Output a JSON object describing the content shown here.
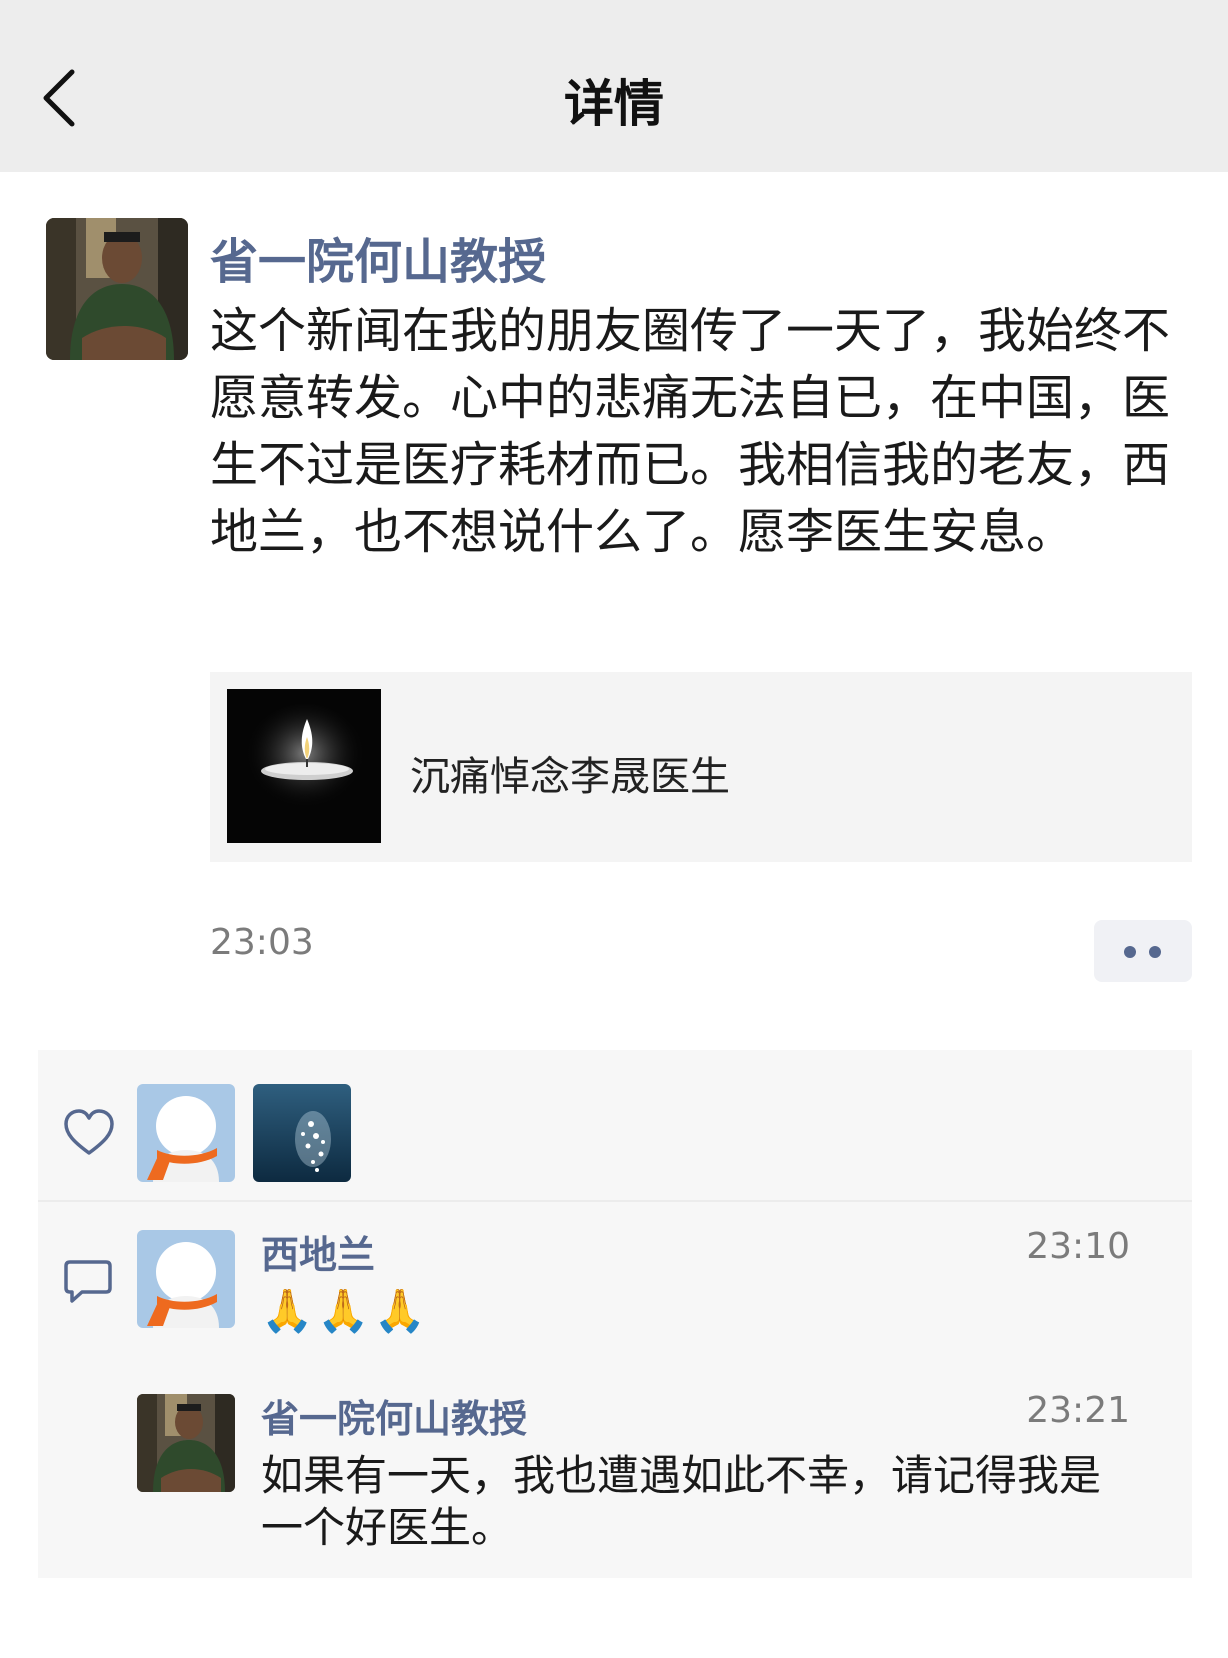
{
  "header": {
    "title": "详情",
    "back_icon": "chevron-left-icon"
  },
  "post": {
    "author": "省一院何山教授",
    "text": "这个新闻在我的朋友圈传了一天了，我始终不愿意转发。心中的悲痛无法自已，在中国，医生不过是医疗耗材而已。我相信我的老友，西地兰，也不想说什么了。愿李医生安息。",
    "link": {
      "title": "沉痛悼念李晟医生",
      "thumb_icon": "candle-icon"
    },
    "time": "23:03",
    "more_icon": "more-dots-icon"
  },
  "likes": {
    "icon": "heart-icon",
    "users": [
      "avatar-scarf",
      "avatar-water"
    ]
  },
  "comments": {
    "icon": "comment-icon",
    "items": [
      {
        "author": "西地兰",
        "time": "23:10",
        "text": "🙏🙏🙏"
      },
      {
        "author": "省一院何山教授",
        "time": "23:21",
        "text": "如果有一天，我也遭遇如此不幸，请记得我是一个好医生。"
      }
    ]
  },
  "colors": {
    "name": "#56688f",
    "header_bg": "#ededed",
    "box_bg": "#f7f7f7"
  }
}
